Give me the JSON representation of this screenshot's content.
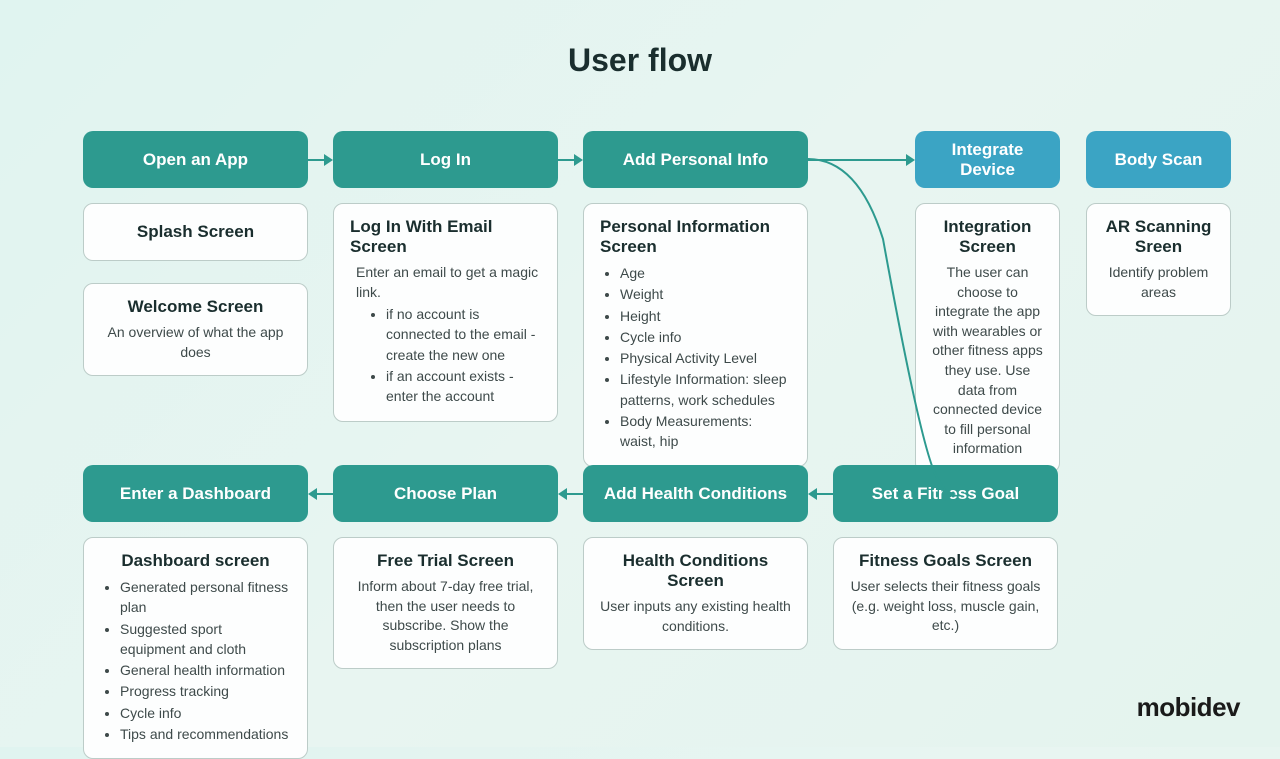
{
  "title": "User flow",
  "logo": "mobidev",
  "nodes": {
    "open_app": {
      "header": "Open an App"
    },
    "log_in": {
      "header": "Log In"
    },
    "add_personal": {
      "header": "Add Personal Info"
    },
    "integrate": {
      "header": "Integrate Device"
    },
    "body_scan": {
      "header": "Body Scan"
    },
    "enter_dash": {
      "header": "Enter a Dashboard"
    },
    "choose_plan": {
      "header": "Choose Plan"
    },
    "add_health": {
      "header": "Add Health Conditions"
    },
    "set_goal": {
      "header": "Set a Fitness Goal"
    }
  },
  "cards": {
    "splash": {
      "title": "Splash Screen"
    },
    "welcome": {
      "title": "Welcome Screen",
      "text": "An overview of what the app does"
    },
    "login_email": {
      "title": "Log In With Email Screen",
      "text": "Enter an email to get a magic link.",
      "items": [
        "if no account is connected to the email - create the new one",
        "if an account exists - enter the account"
      ]
    },
    "personal_info": {
      "title": "Personal Information Screen",
      "items": [
        "Age",
        "Weight",
        "Height",
        "Cycle info",
        "Physical Activity Level",
        "Lifestyle Information: sleep patterns, work schedules",
        "Body Measurements: waist, hip"
      ]
    },
    "integration": {
      "title": "Integration Screen",
      "text": "The user can choose to integrate the app with wearables or other fitness apps they use. Use data from connected device to fill personal information"
    },
    "ar_scan": {
      "title": "AR Scanning Sreen",
      "text": "Identify problem areas"
    },
    "dashboard": {
      "title": "Dashboard screen",
      "items": [
        "Generated personal fitness plan",
        "Suggested sport equipment and cloth",
        "General health information",
        "Progress tracking",
        "Cycle info",
        "Tips and recommendations"
      ]
    },
    "free_trial": {
      "title": "Free Trial Screen",
      "text": "Inform about 7-day free trial, then the user needs to subscribe. Show the subscription plans"
    },
    "health_cond": {
      "title": "Health Conditions Screen",
      "text": "User inputs any existing health conditions."
    },
    "fitness_goals": {
      "title": "Fitness Goals Screen",
      "text": "User selects their fitness goals (e.g. weight loss, muscle gain, etc.)"
    }
  }
}
